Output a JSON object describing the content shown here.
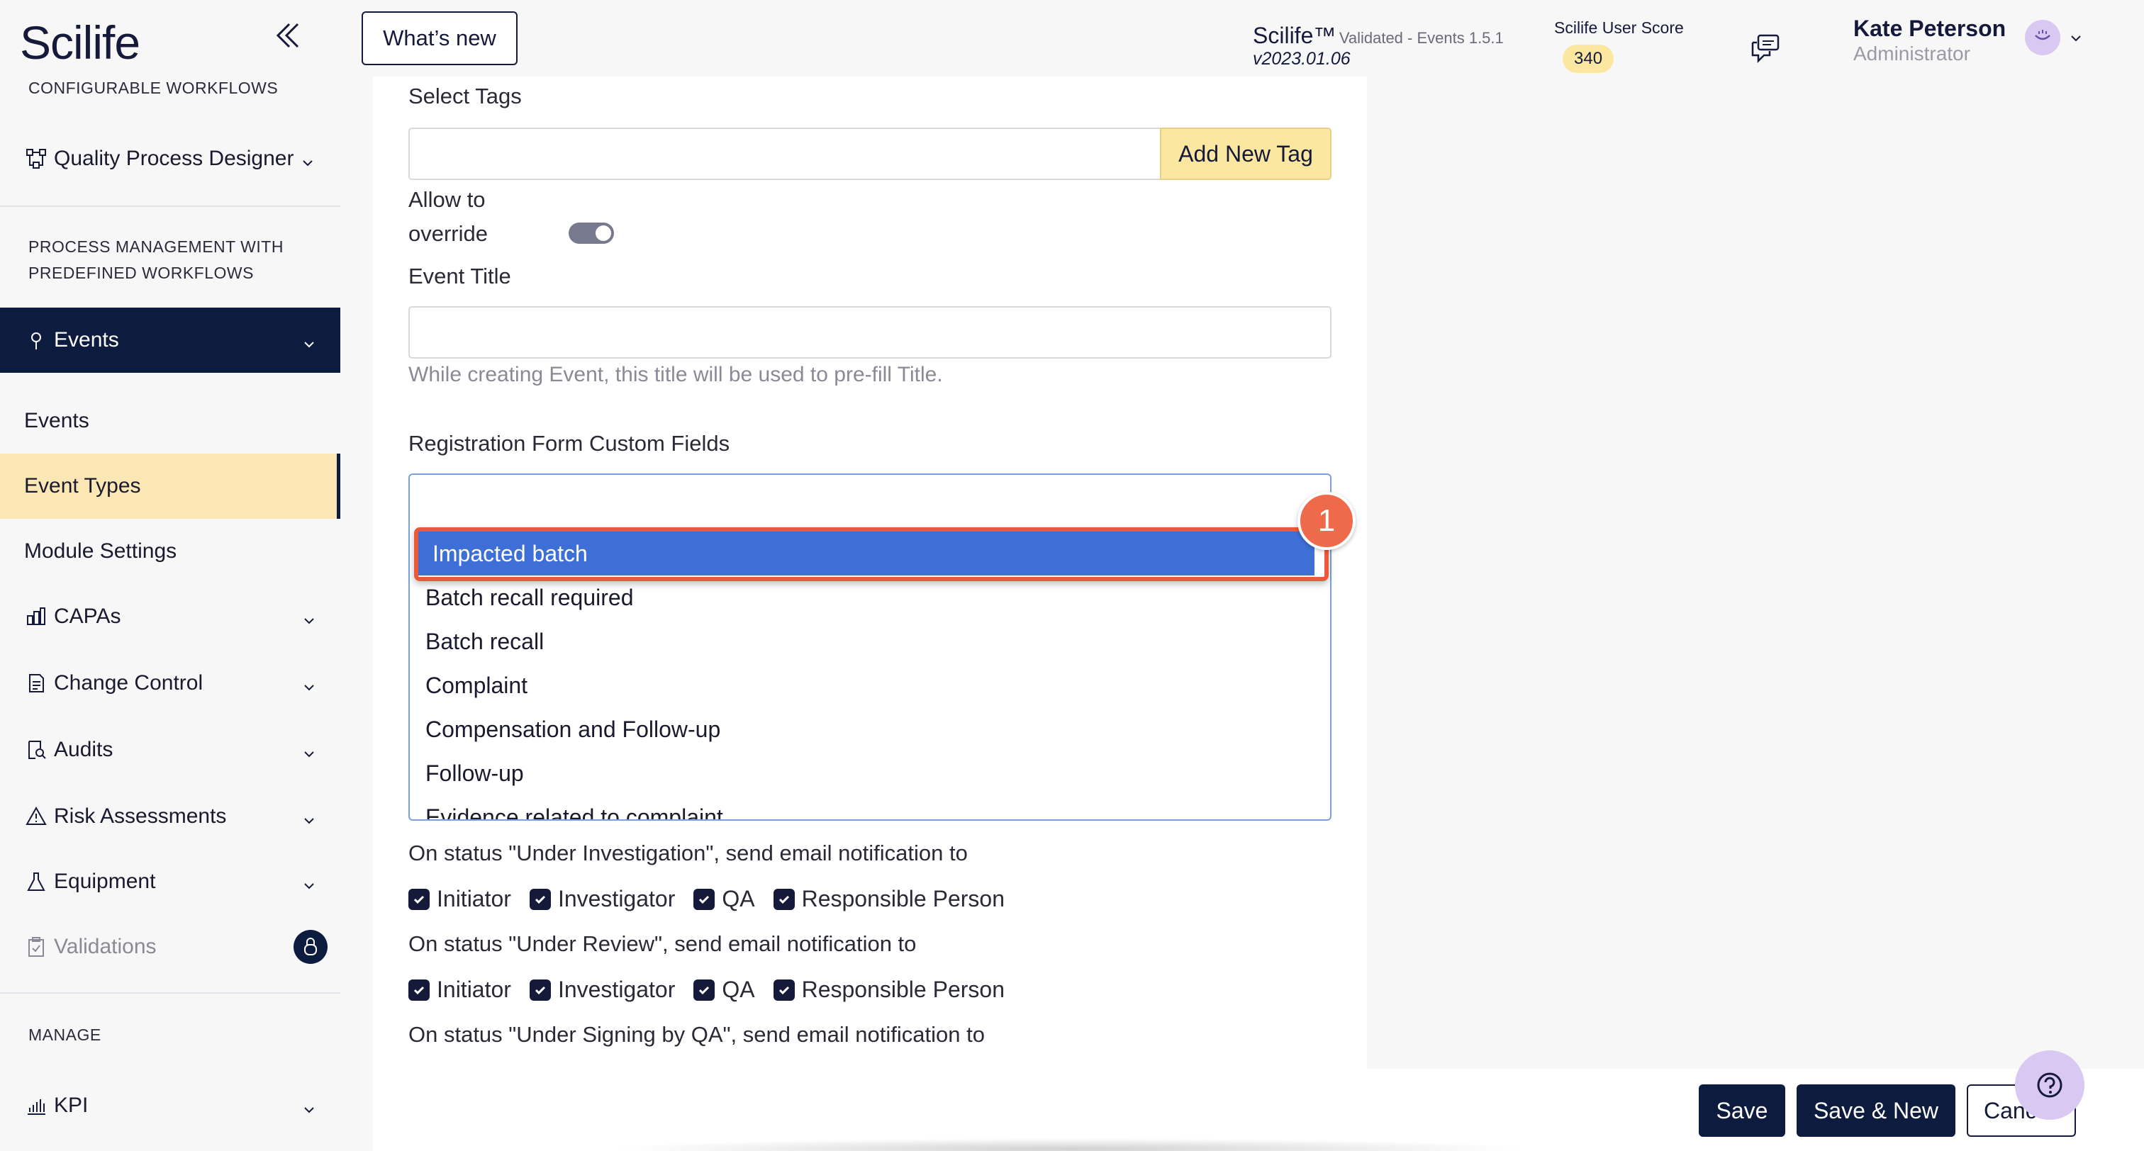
{
  "app": {
    "logo": "Scilife",
    "whats_new": "What’s new",
    "brand": "Scilife™",
    "validated": "Validated - Events 1.5.1",
    "version": "v2023.01.06",
    "score_label": "Scilife User Score",
    "score_value": "340",
    "user_name": "Kate Peterson",
    "user_role": "Administrator"
  },
  "sidebar": {
    "section_configurable": "CONFIGURABLE WORKFLOWS",
    "quality_process_designer": "Quality Process Designer",
    "section_process_line1": "PROCESS MANAGEMENT WITH",
    "section_process_line2": "PREDEFINED WORKFLOWS",
    "events_group": "Events",
    "sub_events": "Events",
    "sub_event_types": "Event Types",
    "sub_module_settings": "Module Settings",
    "capas": "CAPAs",
    "change_control": "Change Control",
    "audits": "Audits",
    "risk_assessments": "Risk Assessments",
    "equipment": "Equipment",
    "validations": "Validations",
    "section_manage": "MANAGE",
    "kpi": "KPI"
  },
  "form": {
    "select_tags_label": "Select Tags",
    "add_new_tag": "Add New Tag",
    "allow_override_line1": "Allow to",
    "allow_override_line2": "override",
    "allow_override_on": true,
    "event_title_label": "Event Title",
    "event_title_value": "",
    "event_title_helper": "While creating Event, this title will be used to pre-fill Title.",
    "custom_fields_label": "Registration Form Custom Fields",
    "custom_fields_options": [
      "Impacted batch",
      "Batch recall required",
      "Batch recall",
      "Complaint",
      "Compensation and Follow-up",
      "Follow-up",
      "Evidence related to complaint"
    ],
    "selected_option": "Impacted batch",
    "step_badge": "1",
    "notif_investigation": "On status \"Under Investigation\", send email notification to",
    "notif_review": "On status \"Under Review\", send email notification to",
    "notif_signing": "On status \"Under Signing by QA\", send email notification to",
    "recipients": [
      "Initiator",
      "Investigator",
      "QA",
      "Responsible Person"
    ]
  },
  "footer": {
    "save": "Save",
    "save_new": "Save & New",
    "cancel": "Cancel"
  },
  "colors": {
    "navy": "#0d1b3e",
    "highlight_yellow": "#fbe7b3",
    "selection_blue": "#3e6fd6",
    "annotation_orange": "#ea5a3a"
  }
}
